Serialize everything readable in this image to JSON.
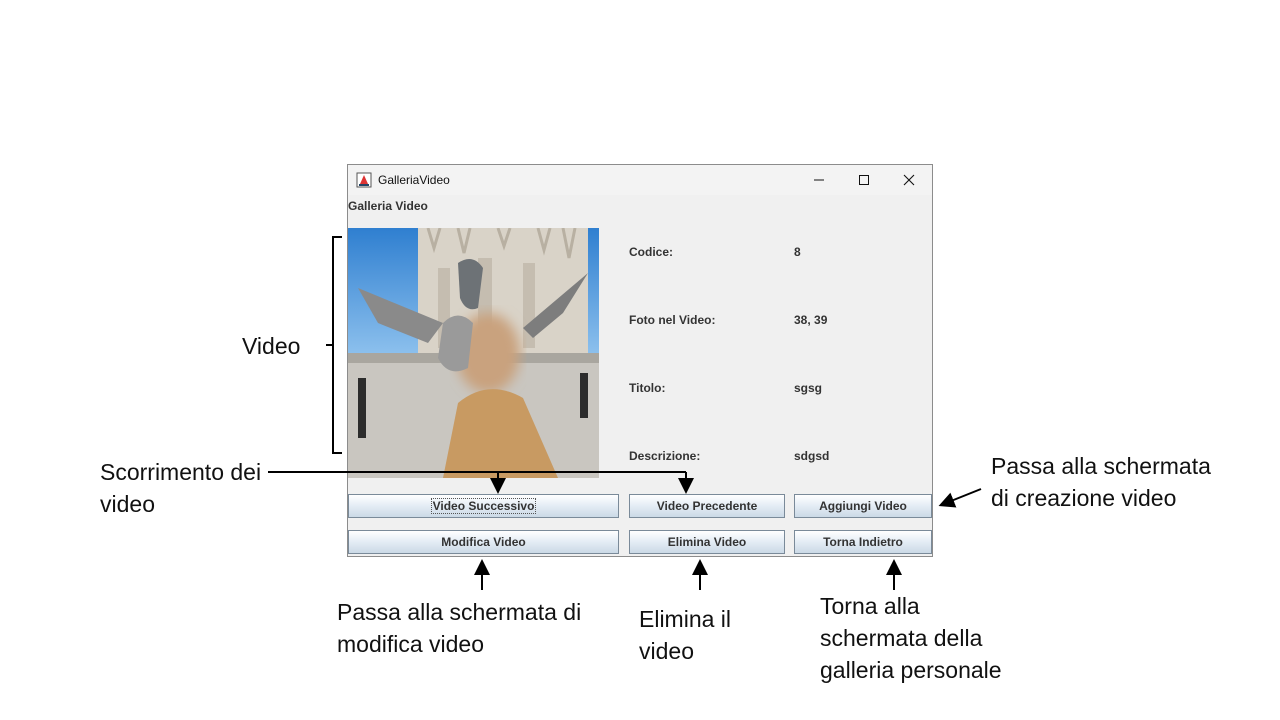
{
  "window": {
    "title": "GalleriaVideo",
    "header": "Galleria Video"
  },
  "fields": [
    {
      "label": "Codice:",
      "value": "8"
    },
    {
      "label": "Foto nel Video:",
      "value": "38, 39"
    },
    {
      "label": "Titolo:",
      "value": "sgsg"
    },
    {
      "label": "Descrizione:",
      "value": "sdgsd"
    }
  ],
  "buttons": {
    "next": "Video Successivo",
    "prev": "Video Precedente",
    "add": "Aggiungi Video",
    "edit": "Modifica Video",
    "delete": "Elimina Video",
    "back": "Torna Indietro"
  },
  "annotations": {
    "video": "Video",
    "scroll_line1": "Scorrimento dei",
    "scroll_line2": "video",
    "create_line1": "Passa alla schermata",
    "create_line2": "di creazione video",
    "edit_line1": "Passa alla schermata di",
    "edit_line2": "modifica video",
    "delete_line1": "Elimina il",
    "delete_line2": "video",
    "back_line1": "Torna alla",
    "back_line2": "schermata della",
    "back_line3": "galleria personale"
  }
}
